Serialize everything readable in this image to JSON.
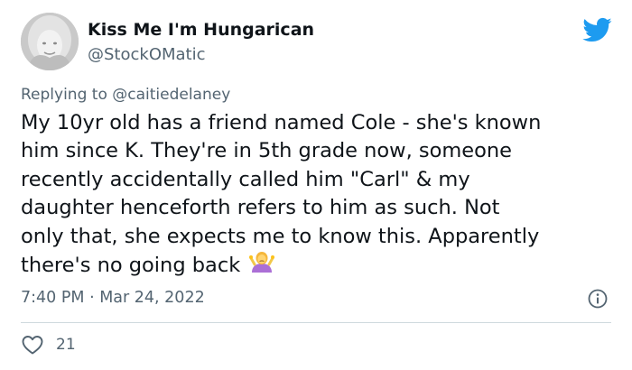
{
  "tweet": {
    "author": {
      "display_name": "Kiss Me I'm Hungarican",
      "handle": "@StockOMatic"
    },
    "replying_to": {
      "prefix": "Replying to",
      "mention": "@caitiedelaney"
    },
    "body_lines": [
      "My 10yr old has a friend named Cole - she's known",
      "him since K. They're in 5th grade now, someone",
      "recently accidentally called him \"Carl\" & my",
      "daughter henceforth refers to him as such. Not",
      "only that, she expects me to know this. Apparently",
      "there's no going back"
    ],
    "emoji": "person-shrugging-emoji",
    "timestamp": "7:40 PM · Mar 24, 2022",
    "like_count": "21"
  },
  "icons": {
    "brand": "twitter-bird-icon",
    "info": "info-icon",
    "like": "heart-icon"
  },
  "colors": {
    "text": "#0f1419",
    "secondary": "#536471",
    "brand_blue": "#1d9bf0",
    "divider": "#cfd9de"
  }
}
